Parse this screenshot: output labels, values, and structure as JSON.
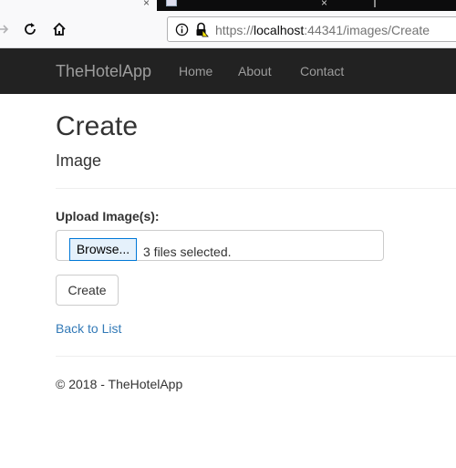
{
  "browser": {
    "url_prefix": "https://",
    "url_host": "localhost",
    "url_rest": ":44341/images/Create",
    "toolbar_icons": [
      "forward-icon",
      "reload-icon",
      "home-icon",
      "info-icon",
      "lock-warning-icon"
    ]
  },
  "navbar": {
    "brand": "TheHotelApp",
    "links": [
      {
        "label": "Home"
      },
      {
        "label": "About"
      },
      {
        "label": "Contact"
      }
    ]
  },
  "page": {
    "title": "Create",
    "subtitle": "Image"
  },
  "form": {
    "upload_label": "Upload Image(s):",
    "browse_label": "Browse...",
    "file_status": "3 files selected.",
    "submit_label": "Create"
  },
  "back_link": "Back to List",
  "footer": "© 2018 - TheHotelApp",
  "colors": {
    "navbar_bg": "#222222",
    "nav_text": "#9d9d9d",
    "link": "#337ab7"
  }
}
